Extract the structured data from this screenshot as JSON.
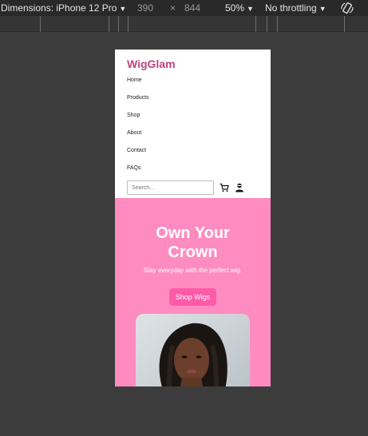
{
  "devtools": {
    "device_label": "Dimensions: iPhone 12 Pro",
    "width": "390",
    "times": "×",
    "height": "844",
    "zoom": "50%",
    "throttling": "No throttling"
  },
  "site": {
    "logo": "WigGlam",
    "nav": [
      "Home",
      "Products",
      "Shop",
      "About",
      "Contact",
      "FAQs"
    ],
    "search_placeholder": "Search...",
    "icons": [
      "cart-icon",
      "user-icon"
    ],
    "hero": {
      "title": "Own Your Crown",
      "subtitle": "Slay everyday with the perfect wig.",
      "cta": "Shop Wigs"
    }
  },
  "colors": {
    "brand": "#c1437a",
    "hero_bg": "#ff8cc0",
    "cta_bg": "#ff5aa8"
  }
}
